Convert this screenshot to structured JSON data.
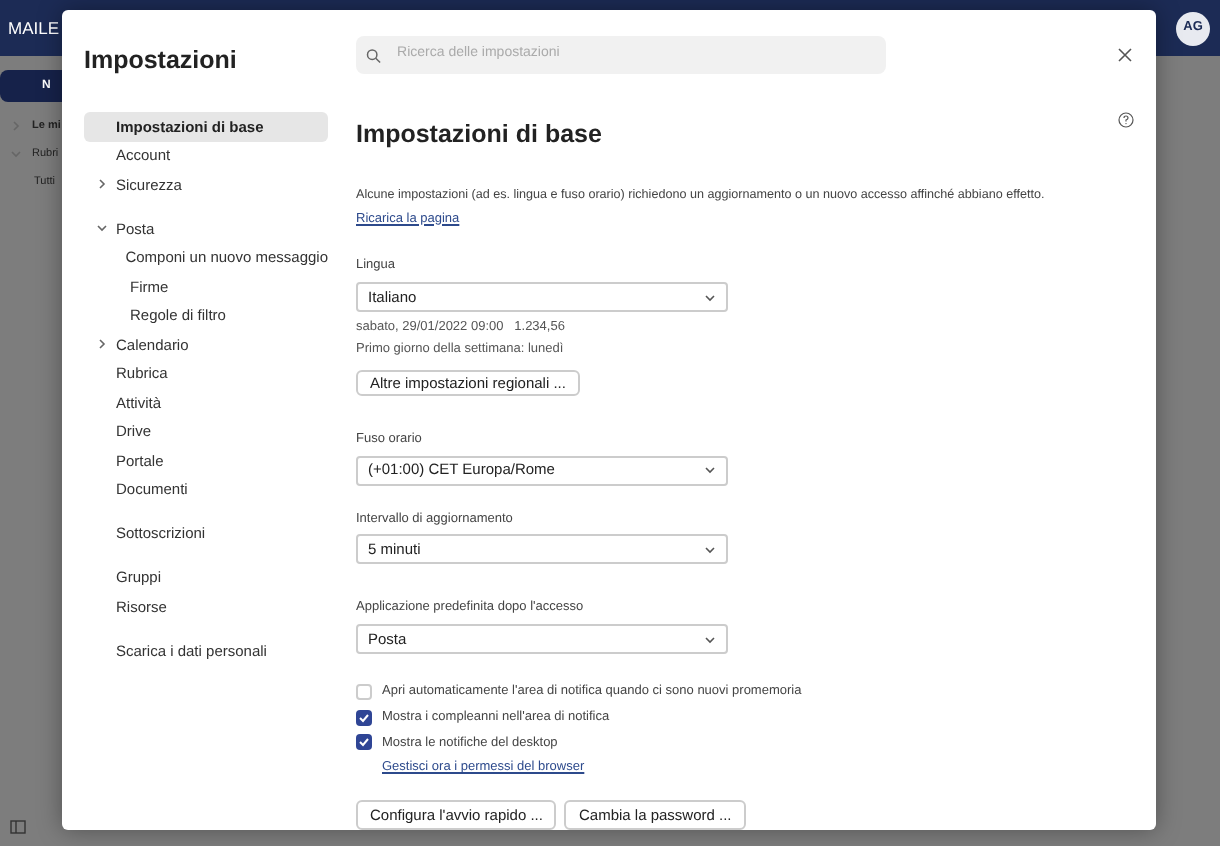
{
  "app": {
    "logo": "MAILE",
    "new_button": "N",
    "folders": [
      {
        "label": "Le mi",
        "expanded": false,
        "bold": true
      },
      {
        "label": "Rubri",
        "expanded": true,
        "bold": false,
        "children": [
          {
            "label": "Tutti"
          }
        ]
      }
    ],
    "avatar": "AG"
  },
  "dialog": {
    "title": "Impostazioni",
    "search": {
      "placeholder": "Ricerca delle impostazioni"
    },
    "sidebar": {
      "groups": [
        {
          "items": [
            {
              "label": "Impostazioni di base",
              "selected": true
            },
            {
              "label": "Account",
              "selected": false
            },
            {
              "label": "Sicurezza",
              "selected": false,
              "expanded": false
            }
          ]
        },
        {
          "items": [
            {
              "label": "Posta",
              "selected": false,
              "expanded": true,
              "children": [
                {
                  "label": "Componi un nuovo messaggio",
                  "selected": false
                },
                {
                  "label": "Firme",
                  "selected": false
                },
                {
                  "label": "Regole di filtro",
                  "selected": false
                }
              ]
            },
            {
              "label": "Calendario",
              "selected": false,
              "expanded": false
            },
            {
              "label": "Rubrica",
              "selected": false
            },
            {
              "label": "Attività",
              "selected": false
            },
            {
              "label": "Drive",
              "selected": false
            },
            {
              "label": "Portale",
              "selected": false
            },
            {
              "label": "Documenti",
              "selected": false
            }
          ]
        },
        {
          "items": [
            {
              "label": "Sottoscrizioni",
              "selected": false
            }
          ]
        },
        {
          "items": [
            {
              "label": "Gruppi",
              "selected": false
            },
            {
              "label": "Risorse",
              "selected": false
            }
          ]
        },
        {
          "items": [
            {
              "label": "Scarica i dati personali",
              "selected": false
            }
          ]
        }
      ]
    },
    "content": {
      "heading": "Impostazioni di base",
      "description": "Alcune impostazioni (ad es. lingua e fuso orario) richiedono un aggiornamento o un nuovo accesso affinché abbiano effetto.",
      "reload_link": "Ricarica la pagina",
      "language": {
        "label": "Lingua",
        "value": "Italiano",
        "sample": "sabato, 29/01/2022 09:00   1.234,56",
        "first_day": "Primo giorno della settimana: lunedì",
        "button": "Altre impostazioni regionali ..."
      },
      "selects": [
        {
          "label": "Fuso orario",
          "value": "(+01:00) CET Europa/Rome"
        },
        {
          "label": "Intervallo di aggiornamento",
          "value": "5 minuti"
        },
        {
          "label": "Applicazione predefinita dopo l'accesso",
          "value": "Posta"
        }
      ],
      "checkboxes": [
        {
          "label": "Apri automaticamente l'area di notifica quando ci sono nuovi promemoria",
          "checked": false
        },
        {
          "label": "Mostra i compleanni nell'area di notifica",
          "checked": true
        },
        {
          "label": "Mostra le notifiche del desktop",
          "checked": true,
          "link": "Gestisci ora i permessi del browser"
        }
      ],
      "buttons": [
        "Configura l'avvio rapido ...",
        "Cambia la password ..."
      ]
    }
  }
}
